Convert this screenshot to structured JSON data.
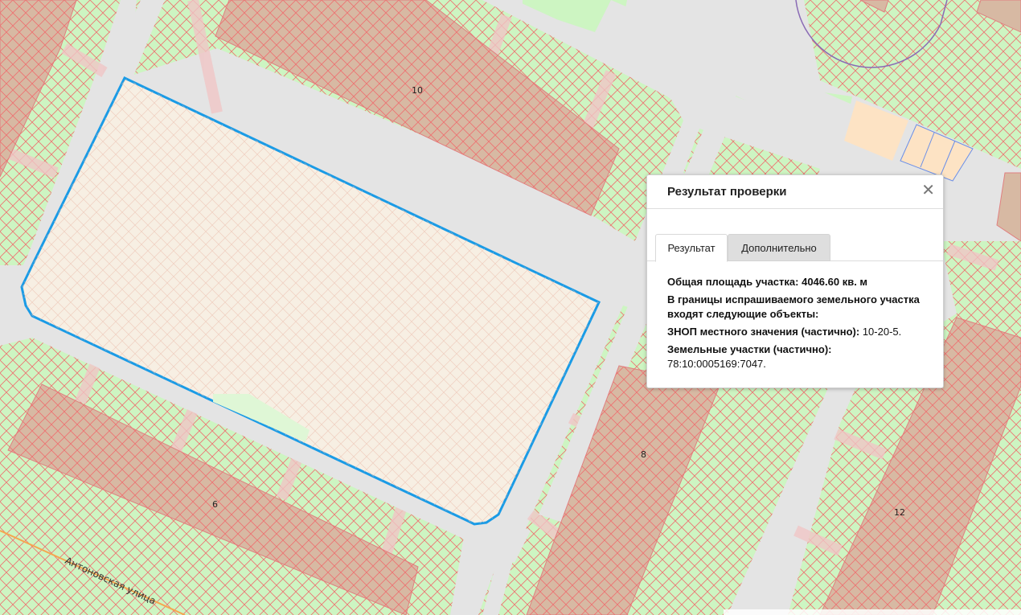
{
  "map": {
    "building_labels": [
      "10",
      "8",
      "6",
      "12"
    ],
    "street_label": "Антоновская улица",
    "colors": {
      "background": "#e4e4e4",
      "green_zone": "#cdf5c2",
      "hatch_red": "#ef6a6a",
      "building_fill": "#d7b9a3",
      "selection_outline": "#1a9be6",
      "selection_fill": "#f7efe3",
      "orange_zone": "#fde3c4"
    }
  },
  "popup": {
    "title": "Результат проверки",
    "close_icon": "close-icon",
    "tabs": [
      "Результат",
      "Дополнительно"
    ],
    "area_label": "Общая площадь участка:",
    "area_value": "4046.60 кв. м",
    "intersect_heading": "В границы испрашиваемого земельного участка входят следующие объекты:",
    "znop_label": "ЗНОП местного значения (частично):",
    "znop_value": "10-20-5.",
    "parcels_label": "Земельные участки (частично):",
    "parcels_value": "78:10:0005169:7047."
  }
}
